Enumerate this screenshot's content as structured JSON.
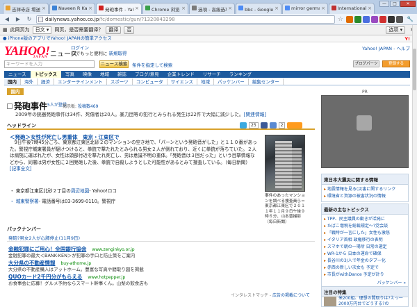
{
  "browser": {
    "tabs": [
      {
        "label": "吉祥寺店 場送下載…",
        "color": "#e8a030"
      },
      {
        "label": "Naveen R Kakarla —",
        "color": "#3b82d6"
      },
      {
        "label": "発砲事件 - Yahoo!…",
        "color": "#d02020"
      },
      {
        "label": "Chrome 浏览器 - 扩…",
        "color": "#3aa04a"
      },
      {
        "label": "选項 - 高級选项",
        "color": "#7a7a7a"
      },
      {
        "label": "bbc - Google 搜索",
        "color": "#4c8bf5"
      },
      {
        "label": "mirror germany",
        "color": "#4c8bf5"
      },
      {
        "label": "International - SPE…",
        "color": "#c03030"
      }
    ],
    "active_tab": 2,
    "url_host": "dailynews.yahoo.co.jp",
    "url_path": "/fc/domestic/gun/?1320843298",
    "ext_icons": [
      "#e06a00",
      "#2a8a2a",
      "#4a6ee0",
      "#9a4ac0",
      "#d03030",
      "#333333",
      "#555555"
    ],
    "min": "—",
    "max": "□",
    "close": "✕",
    "star": "☆",
    "wrench": "🔧"
  },
  "translate_bar": {
    "prefix": "此网页为",
    "lang": "日文",
    "question": "网页，是否需要翻译？",
    "translate_btn": "翻译",
    "no_btn": "否",
    "options": "选项"
  },
  "yahoo_bar": {
    "link": "● iPhone版のアプリでYahoo! JAPANの簡単アクセス",
    "brand": "Y!"
  },
  "header": {
    "logo": "YAHOO!",
    "logo_sub": "JAPAN",
    "section": "ニュース",
    "login": "ログイン",
    "login_note": "IDでもっと便利に",
    "signup": "新規取得",
    "top": "Yahoo! JAPAN",
    "help": "ヘルプ"
  },
  "search": {
    "placeholder": "キーワードを入力",
    "button": "ニュース検索",
    "advanced": "条件を指定して検索",
    "btn_left": "ブログパーツ",
    "btn_right": "登録する"
  },
  "nav": [
    "ニュース",
    "トピックス",
    "写真",
    "映像",
    "地域",
    "雑誌",
    "ブログ/意見",
    "企業トレンド",
    "リサーチ",
    "ランキング"
  ],
  "nav_active": 1,
  "subnav": [
    "国内",
    "海外",
    "経済",
    "エンターテインメント",
    "スポーツ",
    "コンピュータ",
    "サイエンス",
    "地域",
    "パッケンバー",
    "編集センター"
  ],
  "subnav_active": 0,
  "category_tag": "国内",
  "article": {
    "title": "発砲事件",
    "likes": "5人が登録",
    "kiji_label": "掲示板:",
    "kiji_link": "投稿数469",
    "summary": "2009年の銃器発砲事件は34件、死傷者は20人。暴力団等の犯行とみられる発生は22件で大幅に減少した。",
    "summary_link": "[関連情報]",
    "section": "ヘッドライン",
    "social_counts": [
      "25",
      "2"
    ],
    "headline": "＜発砲＞女性が死亡し男重体　東京・江東区で",
    "body": "　9日午後7時45分ごろ、東京都江東区北砂２のマンションの空き地で、「パーンという発砲音がした」と１１０番があった。警視庁城東署員が駆けつけると、拳銃で撃たれたとみられる男女２人が倒れており、近くに拳銃が落ちていた。２人は病院に運ばれたが、女性は頭部付近を撃たれ死亡し、男は意識不明の重体。「発砲音は３回だった」という目撃情報などから、同署は男が女性に２回発砲した後、拳銃で自殺しようとした可能性があるとみて捜査している。（毎日新聞）",
    "body_link": "[記事全文]",
    "info1": "・ 東京都江東区北砂２丁目の",
    "info1_link": "周辺地図",
    "info1_tail": "- Yahoo!ロコ",
    "info2_link": "・ 城東警察署",
    "info2_tail": "- 電話番号は03-3699-0110。警視庁",
    "caption": "事件のあったマンションを調べる捜査員ら＝東京都江東区で２０１１年１１月９日午後９時６分、山本晋撮影（毎日新聞）"
  },
  "backnumber": {
    "title": "バックナンバー",
    "link": "発砲?男女2人が心肺停止(11月9日)"
  },
  "ads": [
    {
      "title": "金融犯罪にご用心！全国銀行協会",
      "url": "www.zenginkyo.or.jp",
      "desc": "金融犯罪の最大＜BANK-KEN＞が犯罪の手口と防止策をご案内"
    },
    {
      "title": "大分県の不動産情報",
      "url": "buy-athome.jp",
      "desc": "大分県の不動産購入はアットホーム。豊富な写真や間取り図を掲載"
    },
    {
      "title": "QUOカード2千円分がもらえる",
      "url": "www.hotpepper.jp",
      "desc": "お食事会に応募！グルメ予約ならスマート幹事くん。山梨の飲食店も"
    }
  ],
  "ad_footer": "インタレストマッチ -",
  "ad_footer_link": "広告の掲載について",
  "right": {
    "pr": "PR",
    "quake_title": "東日本大震災に関する情報",
    "quake_items": [
      "地震情報を見る(災害に関するリンク",
      "環境省と資源の被害状況の情報"
    ],
    "topics_title": "最新の主なトピックス",
    "topics": [
      "TPP、民主議員の動きが活発に",
      "たばこ増税を総裁規定〜?党会談",
      "「戦時が一言にした」女性も激怒",
      "イタリア首相 政権移行の表明",
      "スマホで朝の一場所 日常の選定",
      "WR-1から 日本の運命で確保",
      "長谷川の3/人で年金のタブー化",
      "赤西の新しい次女も 予定で",
      "市長がwithDance 予定が計り"
    ],
    "pack": "パッケンバー",
    "chuui_title": "注目の特集",
    "chuui_text": "米200組、理想の間取りは?えっ一2000万円台でどうする?の"
  }
}
